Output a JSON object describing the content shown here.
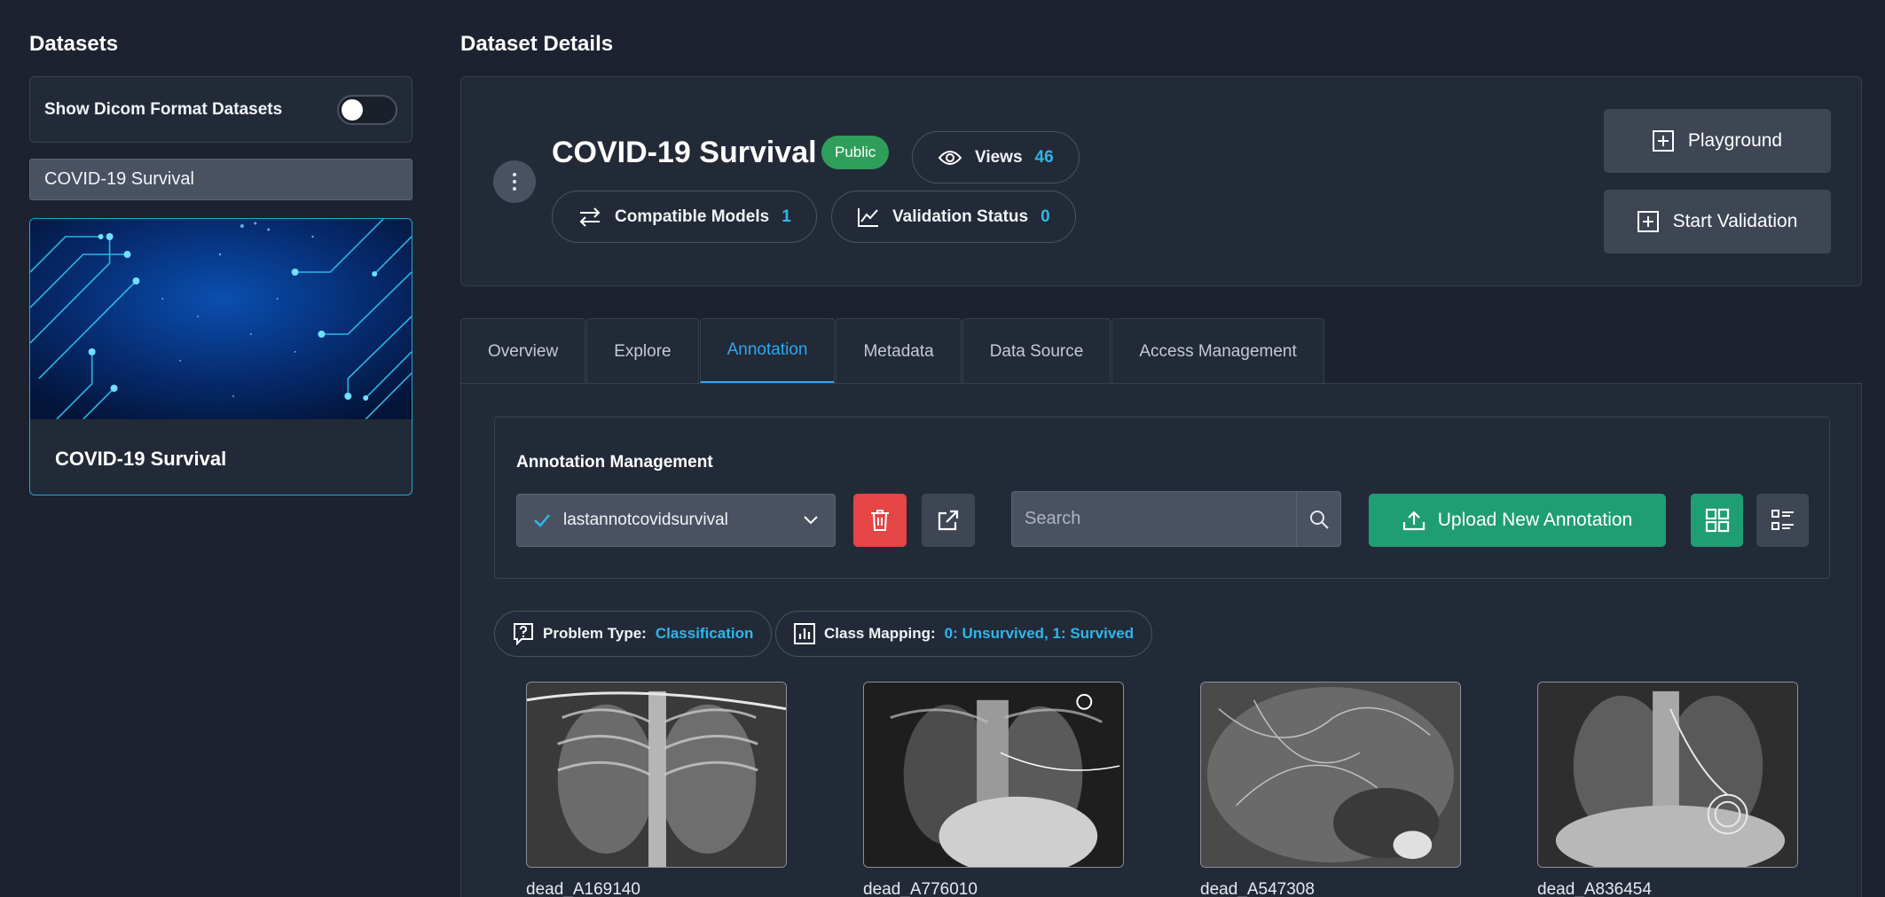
{
  "sidebar": {
    "title": "Datasets",
    "dicom_toggle_label": "Show Dicom Format Datasets",
    "dicom_toggle_on": false,
    "search_value": "COVID-19 Survival",
    "card": {
      "title": "COVID-19 Survival"
    }
  },
  "main": {
    "title": "Dataset Details",
    "dataset": {
      "name": "COVID-19 Survival",
      "visibility": "Public",
      "views_label": "Views",
      "views_count": "46",
      "models_label": "Compatible Models",
      "models_count": "1",
      "validation_label": "Validation Status",
      "validation_count": "0"
    },
    "actions": {
      "playground": "Playground",
      "start_validation": "Start Validation"
    },
    "tabs": [
      {
        "label": "Overview",
        "active": false
      },
      {
        "label": "Explore",
        "active": false
      },
      {
        "label": "Annotation",
        "active": true
      },
      {
        "label": "Metadata",
        "active": false
      },
      {
        "label": "Data Source",
        "active": false
      },
      {
        "label": "Access Management",
        "active": false
      }
    ],
    "annotation": {
      "title": "Annotation Management",
      "selected": "lastannotcovidsurvival",
      "search_placeholder": "Search",
      "upload_label": "Upload New Annotation"
    },
    "info": {
      "problem_type_label": "Problem Type:",
      "problem_type_value": "Classification",
      "class_mapping_label": "Class Mapping:",
      "class_mapping_value": "0: Unsurvived, 1: Survived"
    },
    "thumbnails": [
      {
        "label": "dead_A169140"
      },
      {
        "label": "dead_A776010"
      },
      {
        "label": "dead_A547308"
      },
      {
        "label": "dead_A836454"
      }
    ]
  },
  "colors": {
    "background": "#1c2230",
    "panel": "#232a37",
    "accent_blue": "#2fa8f3",
    "success_green": "#1f9e74",
    "public_badge": "#2f9e5a",
    "danger_red": "#e54545"
  },
  "icons": [
    "toggle-switch",
    "kebab-menu-icon",
    "eye-icon",
    "swap-arrows-icon",
    "line-chart-icon",
    "plus-square-icon",
    "check-icon",
    "chevron-down-icon",
    "trash-icon",
    "external-link-icon",
    "search-icon",
    "upload-icon",
    "grid-view-icon",
    "list-view-icon",
    "question-box-icon",
    "bar-chart-icon"
  ]
}
